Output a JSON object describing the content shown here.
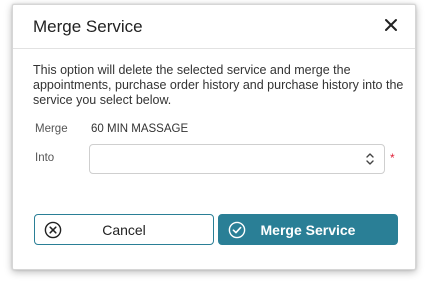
{
  "dialog": {
    "title": "Merge Service",
    "close_icon": "close-icon",
    "description": "This option will delete the selected service and merge the appointments, purchase order history and purchase history into the service you select below.",
    "merge_label": "Merge",
    "merge_value": "60 MIN MASSAGE",
    "into_label": "Into",
    "into_value": "",
    "required_mark": "*",
    "cancel_label": "Cancel",
    "submit_label": "Merge Service"
  },
  "colors": {
    "accent": "#2a7f96",
    "required": "#e0223a",
    "text": "#222222"
  },
  "icons": {
    "cancel": "x-circle-icon",
    "submit": "check-circle-icon",
    "select": "up-down-chevron-icon"
  }
}
